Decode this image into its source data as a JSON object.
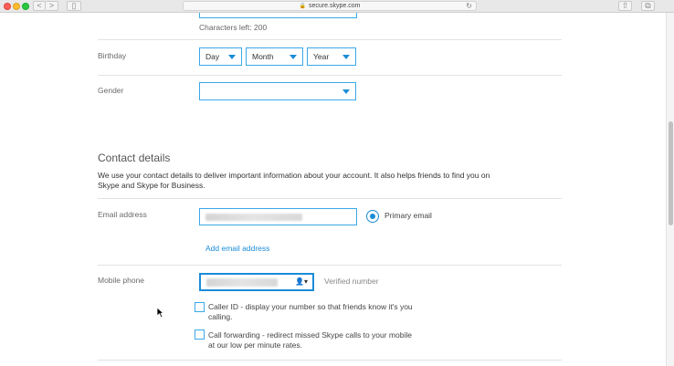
{
  "browser": {
    "url": "secure.skype.com",
    "lock_glyph": "🔒",
    "reload_glyph": "↻",
    "back_glyph": "<",
    "forward_glyph": ">",
    "sidebar_glyph": "▯",
    "share_glyph": "⇧",
    "tabs_glyph": "⧉"
  },
  "profile": {
    "characters_left": "Characters left: 200",
    "birthday": {
      "label": "Birthday",
      "day": "Day",
      "month": "Month",
      "year": "Year"
    },
    "gender": {
      "label": "Gender",
      "value": ""
    }
  },
  "contact": {
    "heading": "Contact details",
    "description": "We use your contact details to deliver important information about your account. It also helps friends to find you on Skype and Skype for Business.",
    "email": {
      "label": "Email address",
      "primary_label": "Primary email",
      "add_link": "Add email address"
    },
    "mobile": {
      "label": "Mobile phone",
      "verified": "Verified number",
      "contact_glyph": "👤▾"
    },
    "options": [
      {
        "label": "Caller ID - display your number so that friends know it's you calling.",
        "checked": false
      },
      {
        "label": "Call forwarding - redirect missed Skype calls to your mobile at our low per minute rates.",
        "checked": false
      }
    ]
  },
  "colors": {
    "accent": "#1a8cd8",
    "border": "#3aa8e8"
  }
}
